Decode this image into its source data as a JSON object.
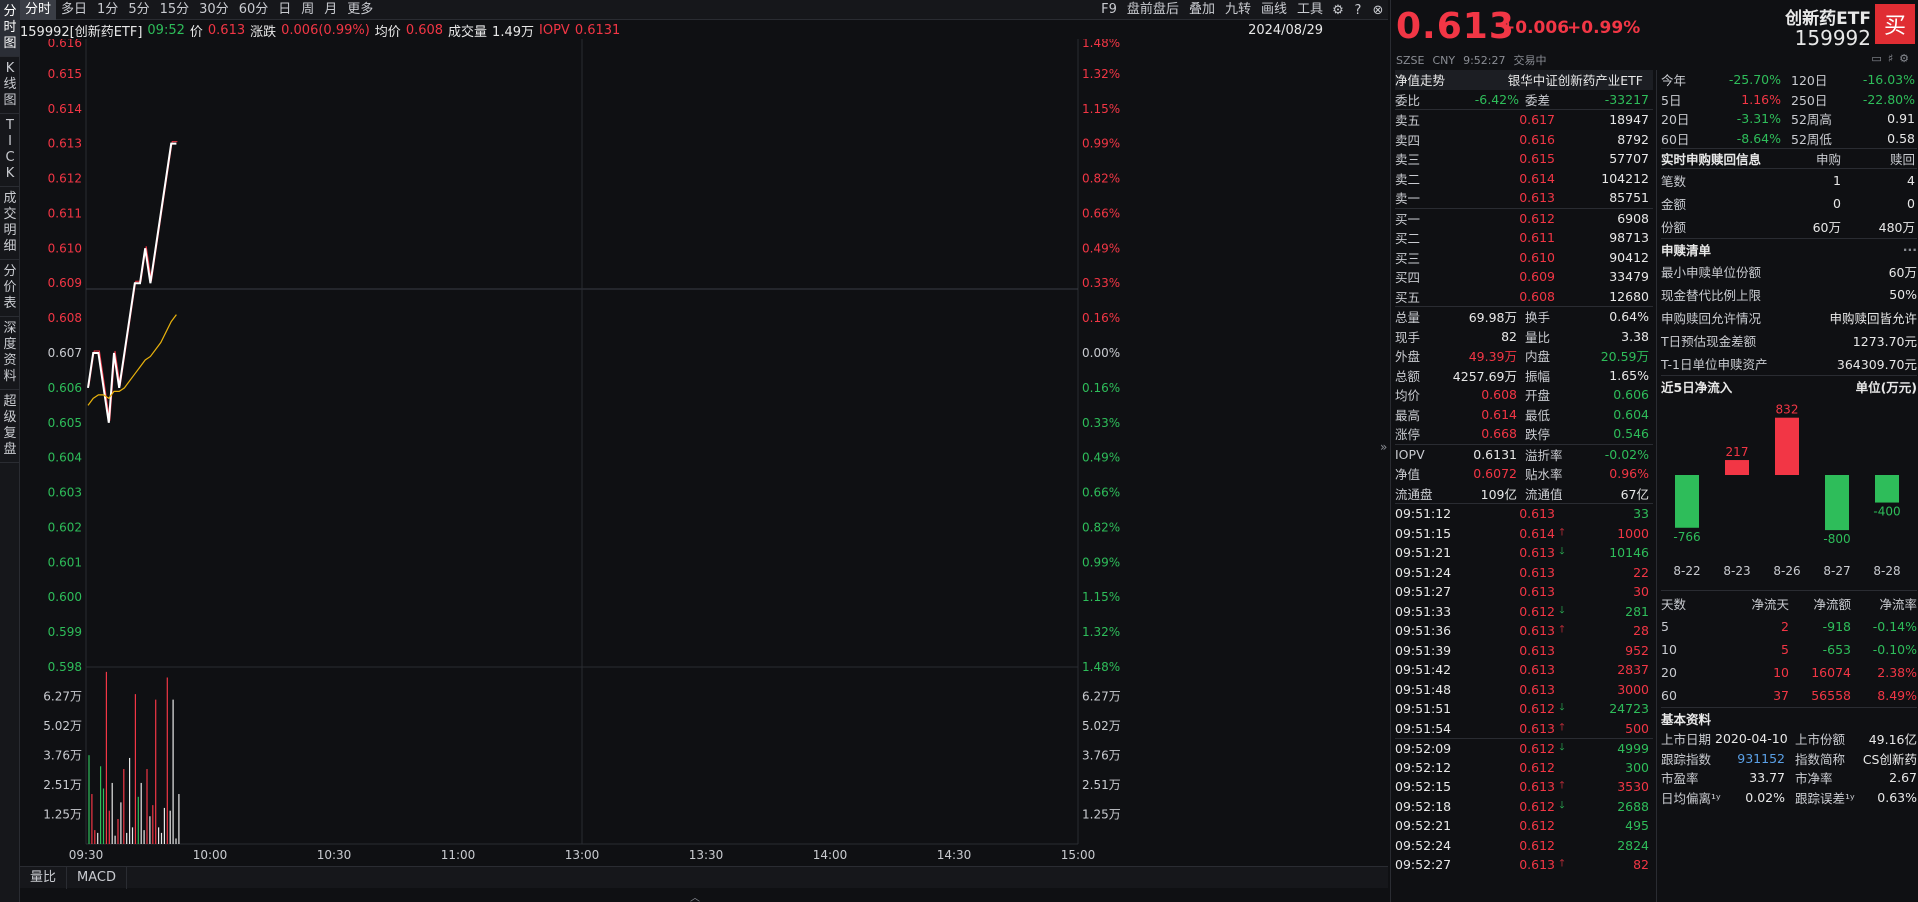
{
  "leftbar": [
    "分时图",
    "K线图",
    "TICK",
    "成交明细",
    "分价表",
    "深度资料",
    "超级复盘"
  ],
  "tabs": [
    "分时",
    "多日",
    "1分",
    "5分",
    "15分",
    "30分",
    "60分",
    "日",
    "周",
    "月",
    "更多"
  ],
  "toolbar": [
    "F9",
    "盘前盘后",
    "叠加",
    "九转",
    "画线",
    "工具"
  ],
  "info": {
    "code": "159992[创新药ETF]",
    "time": "09:52",
    "price_label": "价",
    "price": "0.613",
    "chg_label": "涨跌",
    "chg": "0.006(0.99%)",
    "avg_label": "均价",
    "avg": "0.608",
    "vol_label": "成交量",
    "vol": "1.49万",
    "iopv_label": "IOPV",
    "iopv": "0.6131",
    "date": "2024/08/29"
  },
  "axis": {
    "price_ticks": [
      "0.616",
      "0.615",
      "0.614",
      "0.613",
      "0.612",
      "0.611",
      "0.610",
      "0.609",
      "0.608",
      "0.607",
      "0.606",
      "0.605",
      "0.604",
      "0.603",
      "0.602",
      "0.601",
      "0.600",
      "0.599",
      "0.598"
    ],
    "pct_ticks": [
      "1.48%",
      "1.32%",
      "1.15%",
      "0.99%",
      "0.82%",
      "0.66%",
      "0.49%",
      "0.33%",
      "0.16%",
      "0.00%",
      "0.16%",
      "0.33%",
      "0.49%",
      "0.66%",
      "0.82%",
      "0.99%",
      "1.15%",
      "1.32%",
      "1.48%"
    ],
    "vol_ticks": [
      "6.27万",
      "5.02万",
      "3.76万",
      "2.51万",
      "1.25万"
    ],
    "time_ticks": [
      "09:30",
      "10:00",
      "10:30",
      "11:00",
      "13:00",
      "13:30",
      "14:00",
      "14:30",
      "15:00"
    ]
  },
  "chart_data": {
    "type": "line",
    "price_range": [
      0.598,
      0.616
    ],
    "prev_close": 0.607,
    "series": [
      {
        "values": [
          0.606,
          0.607,
          0.607,
          0.606,
          0.605,
          0.607,
          0.606,
          0.607,
          0.608,
          0.609,
          0.609,
          0.61,
          0.609,
          0.61,
          0.611,
          0.612,
          0.613,
          0.613
        ],
        "color": "#ffffff"
      },
      {
        "values": [
          0.6055,
          0.6057,
          0.6058,
          0.6058,
          0.6057,
          0.6059,
          0.6059,
          0.606,
          0.6062,
          0.6064,
          0.6066,
          0.6068,
          0.6069,
          0.6071,
          0.6073,
          0.6076,
          0.6079,
          0.6081
        ],
        "color": "#e8b20d"
      }
    ],
    "volume_max": 62700,
    "volumes": [
      {
        "v": 32000,
        "c": "g"
      },
      {
        "v": 18000,
        "c": "r"
      },
      {
        "v": 5000,
        "c": "r"
      },
      {
        "v": 4000,
        "c": "w"
      },
      {
        "v": 28000,
        "c": "g"
      },
      {
        "v": 20000,
        "c": "g"
      },
      {
        "v": 62000,
        "c": "r"
      },
      {
        "v": 12000,
        "c": "r"
      },
      {
        "v": 22000,
        "c": "w"
      },
      {
        "v": 3000,
        "c": "w"
      },
      {
        "v": 9000,
        "c": "r"
      },
      {
        "v": 15000,
        "c": "w"
      },
      {
        "v": 27000,
        "c": "r"
      },
      {
        "v": 4000,
        "c": "w"
      },
      {
        "v": 31000,
        "c": "w"
      },
      {
        "v": 6000,
        "c": "w"
      },
      {
        "v": 54000,
        "c": "r"
      },
      {
        "v": 17000,
        "c": "g"
      },
      {
        "v": 22000,
        "c": "w"
      },
      {
        "v": 5000,
        "c": "w"
      },
      {
        "v": 27000,
        "c": "r"
      },
      {
        "v": 10000,
        "c": "w"
      },
      {
        "v": 14000,
        "c": "r"
      },
      {
        "v": 52000,
        "c": "r"
      },
      {
        "v": 6000,
        "c": "w"
      },
      {
        "v": 4000,
        "c": "w"
      },
      {
        "v": 13000,
        "c": "w"
      },
      {
        "v": 60000,
        "c": "r"
      },
      {
        "v": 12000,
        "c": "w"
      },
      {
        "v": 52000,
        "c": "w"
      },
      {
        "v": 2000,
        "c": "w"
      },
      {
        "v": 18000,
        "c": "w"
      }
    ]
  },
  "bottom_tabs": [
    "量比",
    "MACD"
  ],
  "quote": {
    "price": "0.613",
    "chg": "+0.006",
    "chgp": "+0.99%",
    "exchange": "SZSE",
    "currency": "CNY",
    "time": "9:52:27",
    "status": "交易中",
    "name": "创新药ETF",
    "code": "159992",
    "buy": "买"
  },
  "nav": {
    "label": "净值走势",
    "fund": "银华中证创新药产业ETF"
  },
  "weibi": {
    "l1": "委比",
    "v1": "-6.42%",
    "l2": "委差",
    "v2": "-33217"
  },
  "asks": [
    {
      "l": "卖五",
      "p": "0.617",
      "v": "18947"
    },
    {
      "l": "卖四",
      "p": "0.616",
      "v": "8792"
    },
    {
      "l": "卖三",
      "p": "0.615",
      "v": "57707"
    },
    {
      "l": "卖二",
      "p": "0.614",
      "v": "104212"
    },
    {
      "l": "卖一",
      "p": "0.613",
      "v": "85751"
    }
  ],
  "bids": [
    {
      "l": "买一",
      "p": "0.612",
      "v": "6908"
    },
    {
      "l": "买二",
      "p": "0.611",
      "v": "98713"
    },
    {
      "l": "买三",
      "p": "0.610",
      "v": "90412"
    },
    {
      "l": "买四",
      "p": "0.609",
      "v": "33479"
    },
    {
      "l": "买五",
      "p": "0.608",
      "v": "12680"
    }
  ],
  "stats": [
    [
      "总量",
      "69.98万",
      "w",
      "换手",
      "0.64%",
      "w"
    ],
    [
      "现手",
      "82",
      "w",
      "量比",
      "3.38",
      "w"
    ],
    [
      "外盘",
      "49.39万",
      "r",
      "内盘",
      "20.59万",
      "g"
    ],
    [
      "总额",
      "4257.69万",
      "w",
      "振幅",
      "1.65%",
      "w"
    ],
    [
      "均价",
      "0.608",
      "r",
      "开盘",
      "0.606",
      "g"
    ],
    [
      "最高",
      "0.614",
      "r",
      "最低",
      "0.604",
      "g"
    ],
    [
      "涨停",
      "0.668",
      "r",
      "跌停",
      "0.546",
      "g"
    ]
  ],
  "stats2": [
    [
      "IOPV",
      "0.6131",
      "w",
      "溢折率",
      "-0.02%",
      "g"
    ],
    [
      "净值",
      "0.6072",
      "r",
      "贴水率",
      "0.96%",
      "r"
    ],
    [
      "流通盘",
      "109亿",
      "w",
      "流通值",
      "67亿",
      "w"
    ]
  ],
  "ticks": [
    [
      "09:51:12",
      "0.613",
      "",
      "33",
      "g"
    ],
    [
      "09:51:15",
      "0.614",
      "up",
      "1000",
      "r"
    ],
    [
      "09:51:21",
      "0.613",
      "down",
      "10146",
      "g"
    ],
    [
      "09:51:24",
      "0.613",
      "",
      "22",
      "r"
    ],
    [
      "09:51:27",
      "0.613",
      "",
      "30",
      "r"
    ],
    [
      "09:51:33",
      "0.612",
      "down",
      "281",
      "g"
    ],
    [
      "09:51:36",
      "0.613",
      "up",
      "28",
      "r"
    ],
    [
      "09:51:39",
      "0.613",
      "",
      "952",
      "r"
    ],
    [
      "09:51:42",
      "0.613",
      "",
      "2837",
      "r"
    ],
    [
      "09:51:48",
      "0.613",
      "",
      "3000",
      "r"
    ],
    [
      "09:51:51",
      "0.612",
      "down",
      "24723",
      "g"
    ],
    [
      "09:51:54",
      "0.613",
      "up",
      "500",
      "r"
    ],
    [
      "09:52:09",
      "0.612",
      "down",
      "4999",
      "g"
    ],
    [
      "09:52:12",
      "0.612",
      "",
      "300",
      "g"
    ],
    [
      "09:52:15",
      "0.613",
      "up",
      "3530",
      "r"
    ],
    [
      "09:52:18",
      "0.612",
      "down",
      "2688",
      "g"
    ],
    [
      "09:52:21",
      "0.612",
      "",
      "495",
      "g"
    ],
    [
      "09:52:24",
      "0.612",
      "",
      "2824",
      "g"
    ],
    [
      "09:52:27",
      "0.613",
      "up",
      "82",
      "r"
    ]
  ],
  "perf": [
    [
      "今年",
      "-25.70%",
      "g",
      "120日",
      "-16.03%",
      "g"
    ],
    [
      "5日",
      "1.16%",
      "r",
      "250日",
      "-22.80%",
      "g"
    ],
    [
      "20日",
      "-3.31%",
      "g",
      "52周高",
      "0.91",
      "w"
    ],
    [
      "60日",
      "-8.64%",
      "g",
      "52周低",
      "0.58",
      "w"
    ]
  ],
  "sub": {
    "title": "实时申购赎回信息",
    "c1": "申购",
    "c2": "赎回",
    "rows": [
      [
        "笔数",
        "1",
        "4"
      ],
      [
        "金额",
        "0",
        "0"
      ],
      [
        "份额",
        "60万",
        "480万"
      ]
    ]
  },
  "redeem": {
    "title": "申赎清单",
    "more": "···",
    "rows": [
      [
        "最小申赎单位份额",
        "60万"
      ],
      [
        "现金替代比例上限",
        "50%"
      ],
      [
        "申购赎回允许情况",
        "申购赎回皆允许"
      ],
      [
        "T日预估现金差额",
        "1273.70元"
      ],
      [
        "T-1日单位申赎资产",
        "364309.70元"
      ]
    ]
  },
  "flow": {
    "title": "近5日净流入",
    "unit": "单位(万元)",
    "bars": [
      {
        "d": "8-22",
        "v": -766
      },
      {
        "d": "8-23",
        "v": 217
      },
      {
        "d": "8-26",
        "v": 832
      },
      {
        "d": "8-27",
        "v": -800
      },
      {
        "d": "8-28",
        "v": -400
      }
    ]
  },
  "flowtable": {
    "headers": [
      "天数",
      "净流天",
      "净流额",
      "净流率"
    ],
    "rows": [
      [
        "5",
        "2",
        "-918",
        "-0.14%"
      ],
      [
        "10",
        "5",
        "-653",
        "-0.10%"
      ],
      [
        "20",
        "10",
        "16074",
        "2.38%"
      ],
      [
        "60",
        "37",
        "56558",
        "8.49%"
      ]
    ]
  },
  "basic": {
    "title": "基本资料",
    "rows": [
      [
        "上市日期",
        "2020-04-10",
        "w",
        "上市份额",
        "49.16亿",
        "w"
      ],
      [
        "跟踪指数",
        "931152",
        "b",
        "指数简称",
        "CS创新药",
        "w"
      ],
      [
        "市盈率",
        "33.77",
        "w",
        "市净率",
        "2.67",
        "w"
      ],
      [
        "日均偏离¹ʸ",
        "0.02%",
        "w",
        "跟踪误差¹ʸ",
        "0.63%",
        "w"
      ]
    ]
  }
}
